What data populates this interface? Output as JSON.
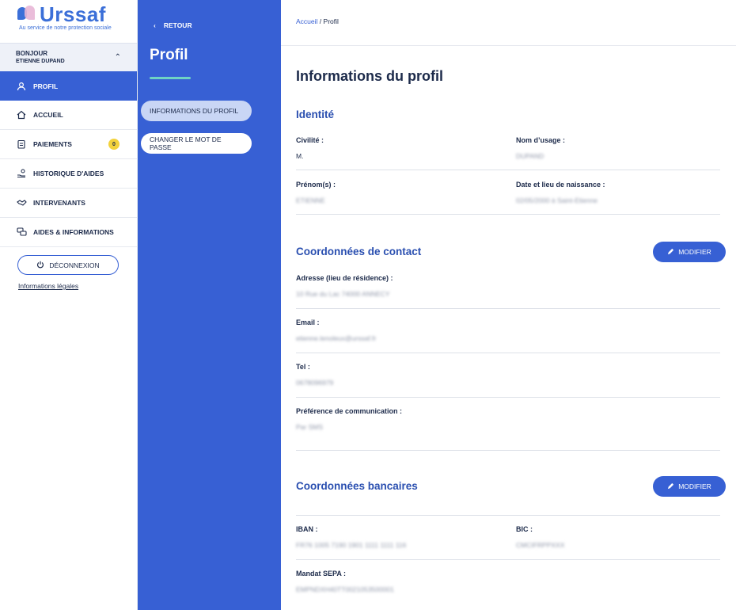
{
  "brand": {
    "name": "Urssaf",
    "tagline": "Au service de notre protection sociale"
  },
  "user": {
    "greeting": "BONJOUR",
    "name": "ETIENNE DUPAND"
  },
  "sidebar": {
    "items": [
      {
        "label": "PROFIL",
        "icon": "user-icon",
        "active": true
      },
      {
        "label": "ACCUEIL",
        "icon": "home-icon"
      },
      {
        "label": "PAIEMENTS",
        "icon": "document-icon",
        "badge": "0"
      },
      {
        "label": "HISTORIQUE D'AIDES",
        "icon": "hand-coins-icon"
      },
      {
        "label": "INTERVENANTS",
        "icon": "handshake-icon"
      },
      {
        "label": "AIDES & INFORMATIONS",
        "icon": "chat-icon"
      }
    ],
    "logout": "DÉCONNEXION",
    "legal": "Informations légales"
  },
  "panel": {
    "back": "RETOUR",
    "title": "Profil",
    "tabs": [
      "INFORMATIONS DU PROFIL",
      "CHANGER LE MOT DE PASSE"
    ]
  },
  "breadcrumb": {
    "home": "Accueil",
    "sep": "/",
    "current": "Profil"
  },
  "main": {
    "title": "Informations du profil",
    "identity": {
      "heading": "Identité",
      "civilite_label": "Civilité :",
      "civilite_value": "M.",
      "nom_label": "Nom d’usage :",
      "nom_value": "DUPAND",
      "prenom_label": "Prénom(s) :",
      "prenom_value": "ETIENNE",
      "naissance_label": "Date et lieu de naissance :",
      "naissance_value": "02/05/2000 à Saint-Etienne"
    },
    "contact": {
      "heading": "Coordonnées de contact",
      "modify": "MODIFIER",
      "adresse_label": "Adresse (lieu de résidence) :",
      "adresse_value": "10 Rue du Lac 74000 ANNECY",
      "email_label": "Email :",
      "email_value": "etienne.lenoleux@urssaf.fr",
      "tel_label": "Tel :",
      "tel_value": "0678096979",
      "pref_label": "Préférence de communication :",
      "pref_value": "Par SMS"
    },
    "bank": {
      "heading": "Coordonnées bancaires",
      "modify": "MODIFIER",
      "iban_label": "IBAN :",
      "iban_value": "FR76 1005 7190 1901 1111 1111 116",
      "bic_label": "BIC :",
      "bic_value": "CMCIFRPPXXX",
      "sepa_label": "Mandat SEPA :",
      "sepa_value": "EMPNDXH40TT0021053500001"
    }
  }
}
